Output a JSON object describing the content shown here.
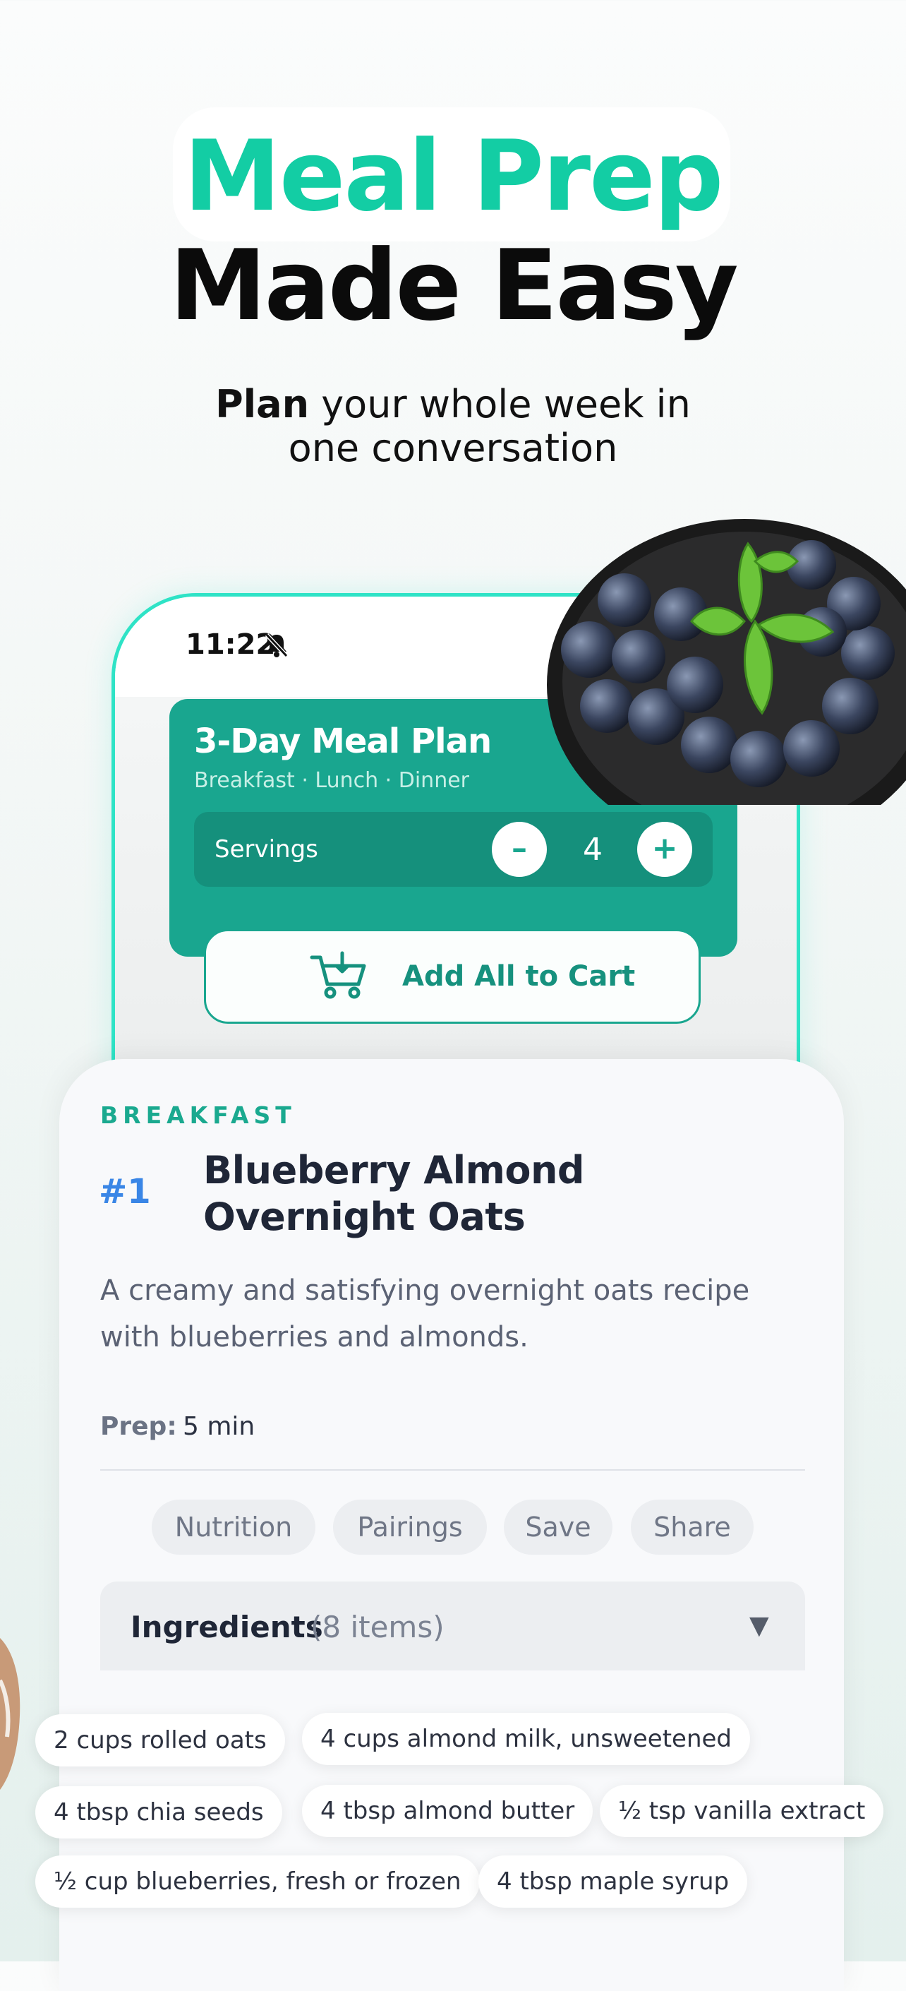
{
  "hero": {
    "title_line1": "Meal Prep",
    "title_line2": "Made Easy",
    "subtitle_bold": "Plan",
    "subtitle_rest_line1": " your whole week in",
    "subtitle_line2": "one conversation"
  },
  "status_bar": {
    "time": "11:22"
  },
  "meal_plan": {
    "title": "3-Day Meal Plan",
    "meals": "Breakfast · Lunch · Dinner",
    "servings_label": "Servings",
    "servings_value": "4",
    "minus": "–",
    "plus": "+",
    "add_all_label": "Add All to Cart"
  },
  "recipe": {
    "category": "BREAKFAST",
    "rank": "#1",
    "title": "Blueberry Almond Overnight Oats",
    "description": "A creamy and satisfying overnight oats recipe with blueberries and almonds.",
    "prep_label": "Prep:",
    "prep_value": "5 min",
    "actions": [
      "Nutrition",
      "Pairings",
      "Save",
      "Share"
    ],
    "ingredients_header": "Ingredients",
    "ingredients_count": "(8 items)",
    "caret": "▼",
    "ingredients": [
      "2 cups rolled oats",
      "4 cups almond milk, unsweetened",
      "4 tbsp chia seeds",
      "4 tbsp almond butter",
      "½ tsp vanilla extract",
      "½ cup blueberries, fresh or frozen",
      "4 tbsp maple syrup"
    ]
  },
  "colors": {
    "accent": "#13cda4",
    "plan_card": "#19a68f",
    "rank_blue": "#3a86e6"
  },
  "icons": [
    "bell-slash-icon",
    "cart-icon",
    "caret-down-icon"
  ]
}
